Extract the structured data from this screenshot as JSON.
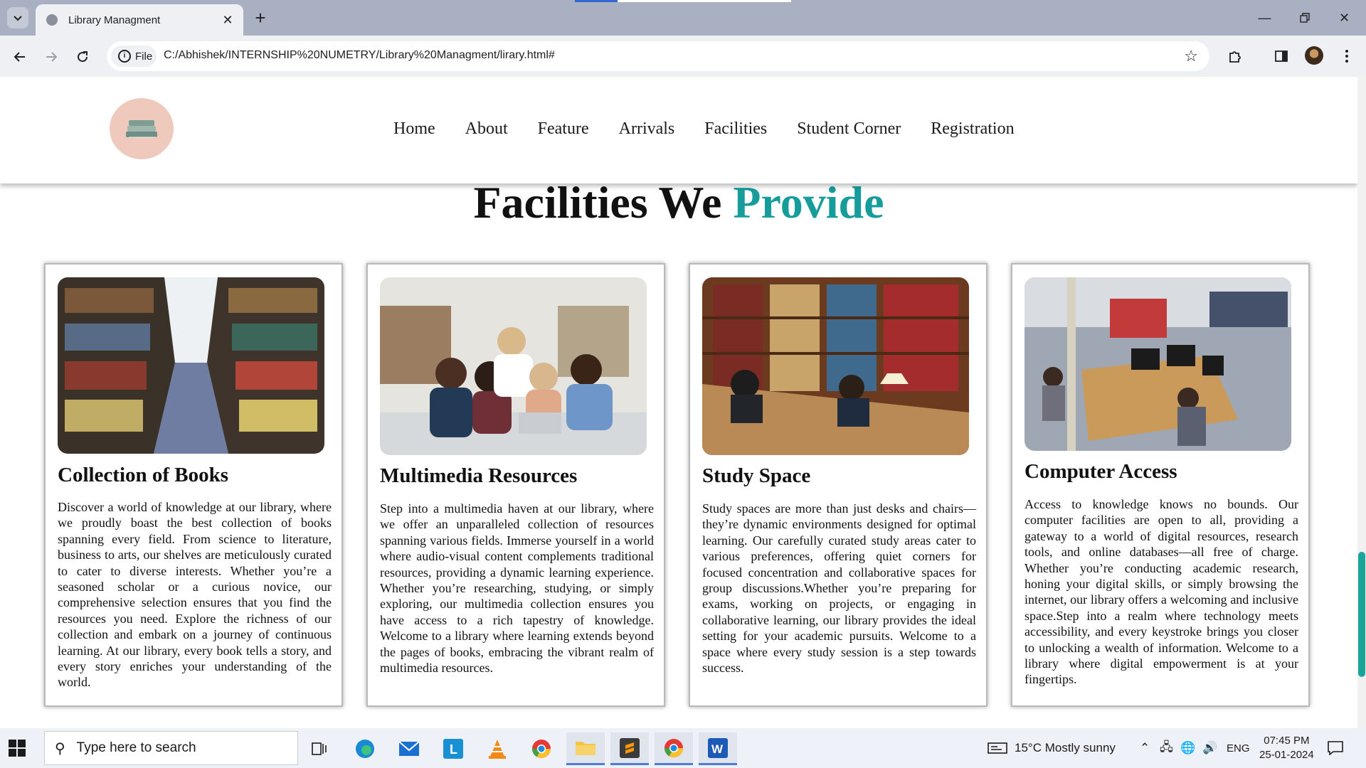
{
  "browser": {
    "tab_title": "Library Managment",
    "url_chip": "File",
    "url": "C:/Abhishek/INTERNSHIP%20NUMETRY/Library%20Managment/lirary.html#"
  },
  "site": {
    "nav": [
      "Home",
      "About",
      "Feature",
      "Arrivals",
      "Facilities",
      "Student Corner",
      "Registration"
    ],
    "section_title_main": "Facilities We",
    "section_title_accent": "Provide",
    "accent_color": "#179c9c",
    "cards": [
      {
        "title": "Collection of Books",
        "text": "Discover a world of knowledge at our library, where we proudly boast the best collection of books spanning every field. From science to literature, business to arts, our shelves are meticulously curated to cater to diverse interests. Whether you’re a seasoned scholar or a curious novice, our comprehensive selection ensures that you find the resources you need. Explore the richness of our collection and embark on a journey of continuous learning. At our library, every book tells a story, and every story enriches your understanding of the world."
      },
      {
        "title": "Multimedia Resources",
        "text": "Step into a multimedia haven at our library, where we offer an unparalleled collection of resources spanning various fields. Immerse yourself in a world where audio-visual content complements traditional resources, providing a dynamic learning experience. Whether you’re researching, studying, or simply exploring, our multimedia collection ensures you have access to a rich tapestry of knowledge. Welcome to a library where learning extends beyond the pages of books, embracing the vibrant realm of multimedia resources."
      },
      {
        "title": "Study Space",
        "text": "Study spaces are more than just desks and chairs—they’re dynamic environments designed for optimal learning. Our carefully curated study areas cater to various preferences, offering quiet corners for focused concentration and collaborative spaces for group discussions.Whether you’re preparing for exams, working on projects, or engaging in collaborative learning, our library provides the ideal setting for your academic pursuits. Welcome to a space where every study session is a step towards success."
      },
      {
        "title": "Computer Access",
        "text": "Access to knowledge knows no bounds. Our computer facilities are open to all, providing a gateway to a world of digital resources, research tools, and online databases—all free of charge. Whether you’re conducting academic research, honing your digital skills, or simply browsing the internet, our library offers a welcoming and inclusive space.Step into a realm where technology meets accessibility, and every keystroke brings you closer to unlocking a wealth of information. Welcome to a library where digital empowerment is at your fingertips."
      }
    ]
  },
  "taskbar": {
    "search_placeholder": "Type here to search",
    "weather": "15°C  Mostly sunny",
    "lang": "ENG",
    "time": "07:45 PM",
    "date": "25-01-2024"
  }
}
